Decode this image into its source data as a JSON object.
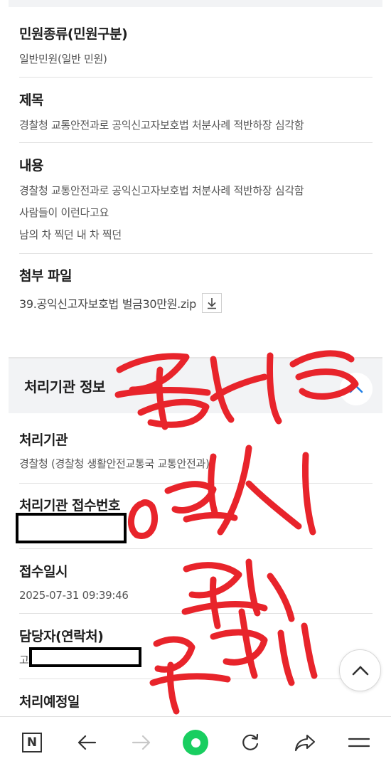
{
  "details": {
    "type_label": "민원종류(민원구분)",
    "type_value": "일반민원(일반 민원)",
    "subject_label": "제목",
    "subject_value": "경찰청 교통안전과로 공익신고자보호법 처분사례 적반하장 심각함",
    "content_label": "내용",
    "content_lines": [
      "경찰청 교통안전과로 공익신고자보호법  처분사례 적반하장 심각함",
      "사람들이 이런다고요",
      "남의 차 찍던 내 차 찍던"
    ],
    "attachment_label": "첨부 파일",
    "attachment_name": "39.공익신고자보호법 벌금30만원.zip"
  },
  "agency_section": {
    "title": "처리기관 정보",
    "agency_label": "처리기관",
    "agency_value": "경찰청 (경찰청 생활안전교통국 교통안전과)",
    "receipt_no_label": "처리기관 접수번호",
    "received_at_label": "접수일시",
    "received_at_value": "2025-07-31 09:39:46",
    "manager_label": "담당자(연락처)",
    "manager_value_visible": "고",
    "due_label": "처리예정일"
  },
  "icons": {
    "download": "download-icon",
    "collapse": "chevron-up-icon",
    "scroll_top": "chevron-up-icon",
    "nav": [
      "naver-home-icon",
      "back-arrow-icon",
      "forward-arrow-icon",
      "green-dot-icon",
      "refresh-icon",
      "share-icon",
      "menu-icon"
    ]
  },
  "nav": {
    "home_letter": "N"
  },
  "colors": {
    "accent_green": "#19ce60",
    "scribble_red": "#e8242b",
    "chevron_blue": "#1e7ee6"
  }
}
